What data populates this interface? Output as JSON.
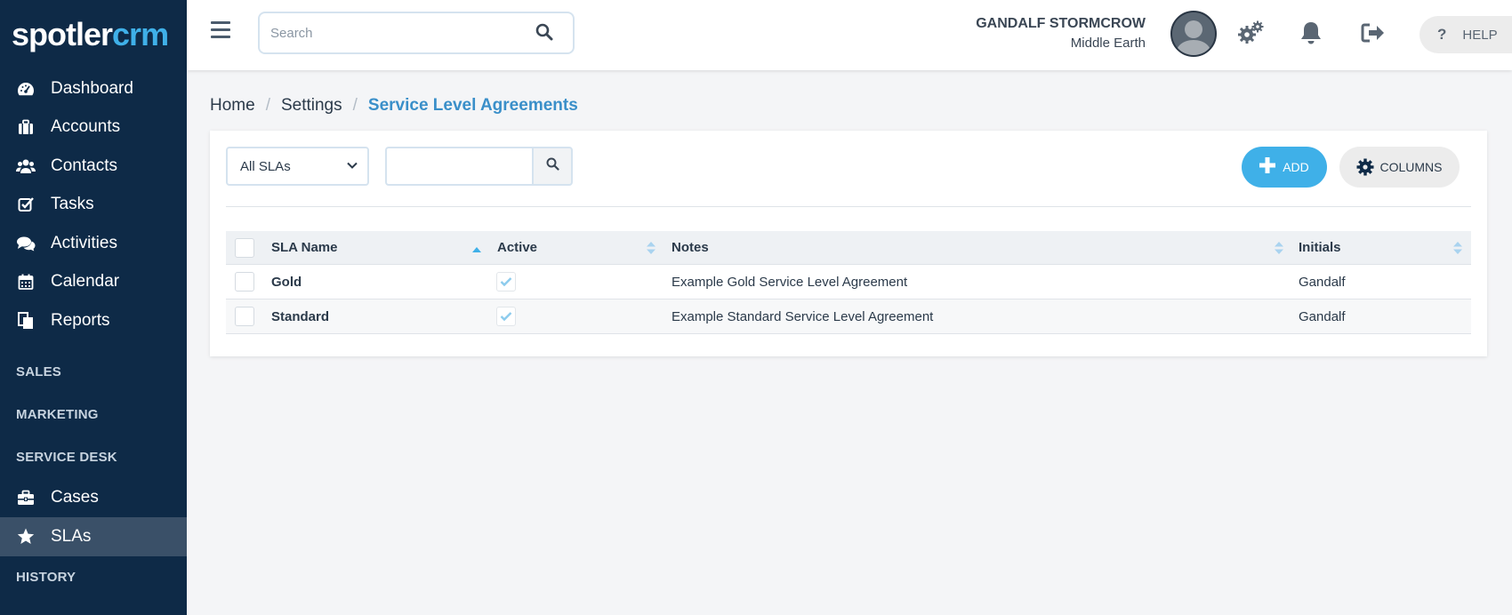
{
  "logo": {
    "part1": "spotler",
    "part2": "crm"
  },
  "sidebar": {
    "nav": [
      {
        "label": "Dashboard",
        "icon": "dashboard-icon"
      },
      {
        "label": "Accounts",
        "icon": "briefcase-icon"
      },
      {
        "label": "Contacts",
        "icon": "users-icon"
      },
      {
        "label": "Tasks",
        "icon": "checkbox-icon"
      },
      {
        "label": "Activities",
        "icon": "comments-icon"
      },
      {
        "label": "Calendar",
        "icon": "calendar-icon"
      },
      {
        "label": "Reports",
        "icon": "documents-icon"
      }
    ],
    "sections": {
      "sales": "SALES",
      "marketing": "MARKETING",
      "service_desk": "SERVICE DESK",
      "history": "HISTORY"
    },
    "service_items": [
      {
        "label": "Cases",
        "icon": "toolbox-icon"
      },
      {
        "label": "SLAs",
        "icon": "star-icon",
        "active": true
      }
    ]
  },
  "header": {
    "search_placeholder": "Search",
    "user_name": "GANDALF STORMCROW",
    "user_org": "Middle Earth",
    "help_label": "HELP",
    "help_glyph": "?"
  },
  "breadcrumb": {
    "home": "Home",
    "settings": "Settings",
    "current": "Service Level Agreements",
    "separator": "/"
  },
  "toolbar": {
    "filter_value": "All SLAs",
    "add_label": "ADD",
    "columns_label": "COLUMNS"
  },
  "table": {
    "columns": {
      "name": "SLA Name",
      "active": "Active",
      "notes": "Notes",
      "initials": "Initials"
    },
    "rows": [
      {
        "name": "Gold",
        "active": true,
        "notes": "Example Gold Service Level Agreement",
        "initials": "Gandalf"
      },
      {
        "name": "Standard",
        "active": true,
        "notes": "Example Standard Service Level Agreement",
        "initials": "Gandalf"
      }
    ]
  },
  "colors": {
    "sidebar_bg": "#0e2a47",
    "accent": "#3fb0e8",
    "breadcrumb_current": "#3a8fc9",
    "active_nav_bg": "#3a5068"
  }
}
